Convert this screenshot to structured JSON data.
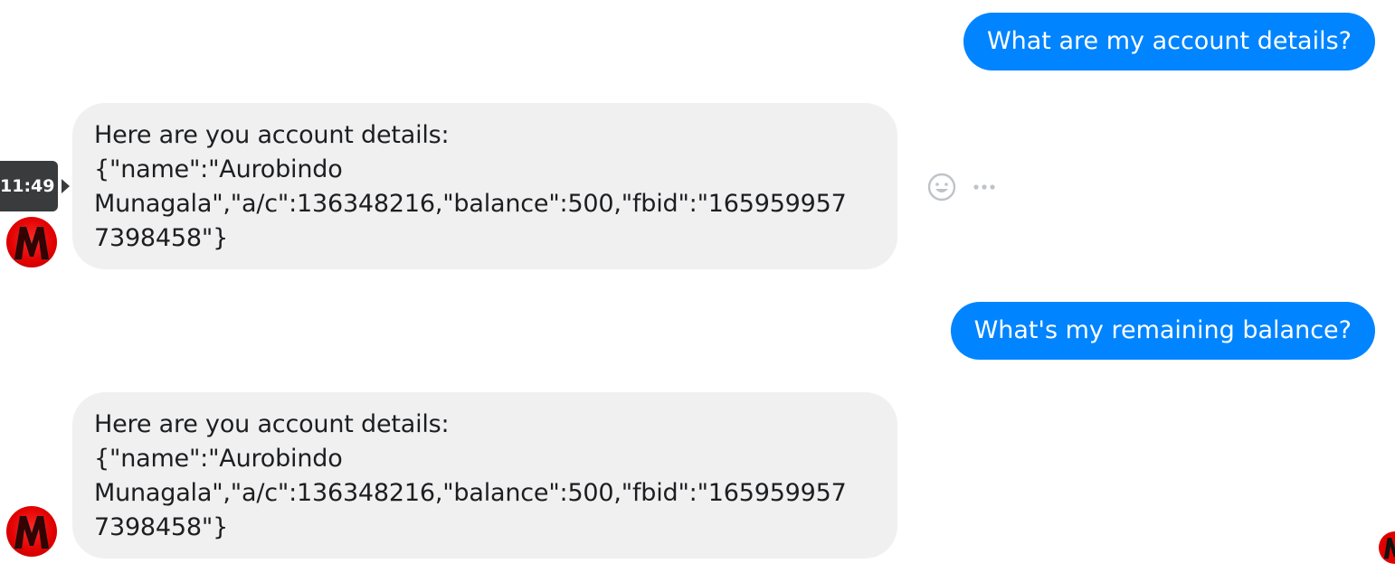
{
  "conversation": {
    "messages": [
      {
        "sender": "user",
        "text": "What are my account details?"
      },
      {
        "sender": "bot",
        "lines": [
          "Here are you account details:",
          "{\"name\":\"Aurobindo",
          "Munagala\",\"a/c\":136348216,\"balance\":500,\"fbid\":\"165959957",
          "7398458\"}"
        ],
        "timestamp": "11:49"
      },
      {
        "sender": "user",
        "text": "What's my remaining balance?"
      },
      {
        "sender": "bot",
        "lines": [
          "Here are you account details:",
          "{\"name\":\"Aurobindo",
          "Munagala\",\"a/c\":136348216,\"balance\":500,\"fbid\":\"165959957",
          "7398458\"}"
        ]
      }
    ]
  },
  "actions": {
    "react_icon": "smiley-face-icon",
    "more_icon": "ellipsis-icon"
  },
  "colors": {
    "outgoing_bubble": "#0084ff",
    "incoming_bubble": "#f1f0f0",
    "tooltip": "#3a3b3c",
    "avatar": "#e00000"
  }
}
